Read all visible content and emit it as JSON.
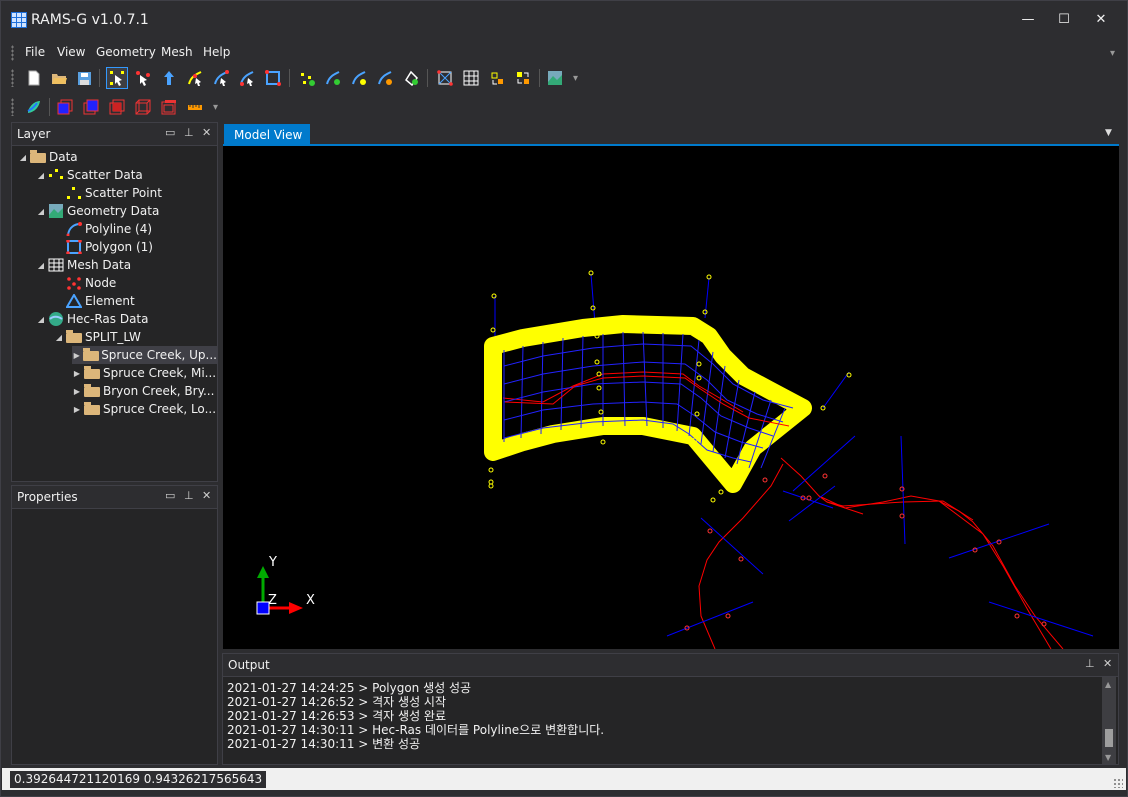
{
  "window": {
    "title": "RAMS-G v1.0.7.1",
    "minimize_glyph": "—",
    "maximize_glyph": "☐",
    "close_glyph": "✕"
  },
  "menu": {
    "items": [
      "File",
      "View",
      "Geometry",
      "Mesh",
      "Help"
    ]
  },
  "toolbar_icons": {
    "row1": [
      "new-file-icon",
      "open-folder-icon",
      "save-icon",
      "select-icon",
      "select-node-icon",
      "move-node-icon",
      "add-vertex-icon",
      "edit-polyline-icon",
      "delete-vertex-icon",
      "polygon-select-icon",
      "scatter-point-icon",
      "polyline-add-icon",
      "polyline-split-icon",
      "polyline-merge-icon",
      "polyline-delete-icon",
      "generate-mesh-icon",
      "mesh-grid-icon",
      "mesh-refine-icon",
      "mesh-export-icon",
      "display-options-icon"
    ],
    "row2": [
      "hec-ras-import-icon",
      "layer-cube-1-icon",
      "layer-cube-2-icon",
      "layer-cube-3-icon",
      "layer-cube-4-icon",
      "layer-cube-5-icon",
      "measure-ruler-icon"
    ]
  },
  "layer_panel": {
    "title": "Layer",
    "tree": [
      {
        "label": "Data",
        "level": 0,
        "expanded": true,
        "icon": "folder-icon"
      },
      {
        "label": "Scatter Data",
        "level": 1,
        "expanded": true,
        "icon": "scatter-data-icon"
      },
      {
        "label": "Scatter Point",
        "level": 2,
        "icon": "scatter-point-icon"
      },
      {
        "label": "Geometry Data",
        "level": 1,
        "expanded": true,
        "icon": "geometry-data-icon"
      },
      {
        "label": "Polyline (4)",
        "level": 2,
        "icon": "polyline-icon"
      },
      {
        "label": "Polygon (1)",
        "level": 2,
        "icon": "polygon-icon"
      },
      {
        "label": "Mesh Data",
        "level": 1,
        "expanded": true,
        "icon": "mesh-data-icon"
      },
      {
        "label": "Node",
        "level": 2,
        "icon": "node-icon"
      },
      {
        "label": "Element",
        "level": 2,
        "icon": "element-icon"
      },
      {
        "label": "Hec-Ras Data",
        "level": 1,
        "expanded": true,
        "icon": "hec-ras-icon"
      },
      {
        "label": "SPLIT_LW",
        "level": 2,
        "expanded": true,
        "icon": "folder-icon"
      },
      {
        "label": "Spruce Creek, Up...",
        "level": 3,
        "collapsed": true,
        "icon": "folder-icon",
        "selected": true
      },
      {
        "label": "Spruce Creek, Mi...",
        "level": 3,
        "collapsed": true,
        "icon": "folder-icon"
      },
      {
        "label": "Bryon Creek, Bry...",
        "level": 3,
        "collapsed": true,
        "icon": "folder-icon"
      },
      {
        "label": "Spruce Creek, Lo...",
        "level": 3,
        "collapsed": true,
        "icon": "folder-icon"
      }
    ]
  },
  "properties_panel": {
    "title": "Properties"
  },
  "model_view": {
    "tab_label": "Model View",
    "axis_y": "Y",
    "axis_z": "Z",
    "axis_x": "X"
  },
  "output_panel": {
    "title": "Output",
    "lines": [
      "2021-01-27 14:24:25 > Polygon 생성 성공",
      "2021-01-27 14:26:52 > 격자 생성 시작",
      "2021-01-27 14:26:53 > 격자 생성 완료",
      "2021-01-27 14:30:11 > Hec-Ras 데이터를 Polyline으로 변환합니다.",
      "2021-01-27 14:30:11 > 변환 성공"
    ]
  },
  "status": {
    "coordinates": "0.392644721120169 0.94326217565643"
  },
  "colors": {
    "accent": "#007acc",
    "polygon_outline": "#ffff00",
    "mesh_lines": "#0000ff",
    "polyline": "#ff0000"
  }
}
